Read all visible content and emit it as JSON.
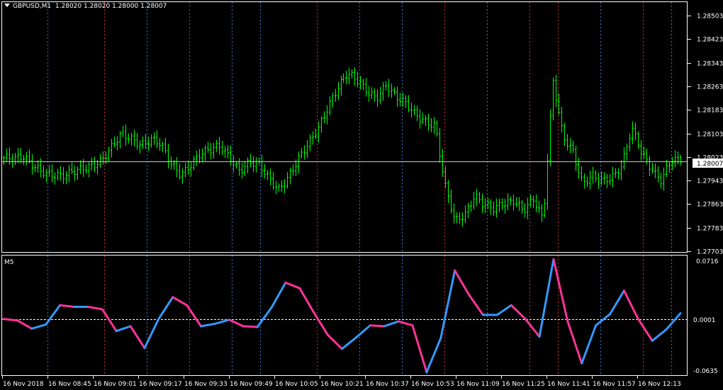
{
  "header": {
    "symbol": "GBPUSD,M1",
    "ohlc": "1.28020 1.28020 1.28000 1.28007",
    "menu_icon": "triangle-down-icon"
  },
  "price_axis": {
    "ticks": [
      1.28503,
      1.28423,
      1.28343,
      1.28263,
      1.28183,
      1.28103,
      1.28023,
      1.27943,
      1.27863,
      1.27783,
      1.27703
    ],
    "current_price": "1.28007",
    "current_value": 1.28007
  },
  "indicator": {
    "name": "M5",
    "max_label": "0.0716",
    "min_label": "-0.0635",
    "zero_label": "0.0001",
    "range": [
      -0.0635,
      0.0716
    ],
    "color_up": "#3399ff",
    "color_down": "#ff3399"
  },
  "time_axis": {
    "labels": [
      "16 Nov 2018",
      "16 Nov 08:45",
      "16 Nov 09:01",
      "16 Nov 09:17",
      "16 Nov 09:33",
      "16 Nov 09:49",
      "16 Nov 10:05",
      "16 Nov 10:21",
      "16 Nov 10:37",
      "16 Nov 10:53",
      "16 Nov 11:09",
      "16 Nov 11:25",
      "16 Nov 11:41",
      "16 Nov 11:57",
      "16 Nov 12:13"
    ]
  },
  "colors": {
    "background": "#000000",
    "bar": "#00ff00",
    "grid_blue": "#3a79c9",
    "grid_red": "#c0323c",
    "text": "#ffffff"
  },
  "chart_data": [
    {
      "type": "line",
      "title": "GBPUSD,M1",
      "ylim": [
        1.27703,
        1.28503
      ],
      "x_labels": [
        "16 Nov 2018",
        "16 Nov 08:45",
        "16 Nov 09:01",
        "16 Nov 09:17",
        "16 Nov 09:33",
        "16 Nov 09:49",
        "16 Nov 10:05",
        "16 Nov 10:21",
        "16 Nov 10:37",
        "16 Nov 10:53",
        "16 Nov 11:09",
        "16 Nov 11:25",
        "16 Nov 11:41",
        "16 Nov 11:57",
        "16 Nov 12:13"
      ],
      "series": [
        {
          "close_approx": [
            1.2802,
            1.2801,
            1.2802,
            1.28,
            1.2798,
            1.2796,
            1.2795,
            1.2797,
            1.2799,
            1.28,
            1.2801,
            1.2805,
            1.281,
            1.2809,
            1.2807,
            1.2808,
            1.2806,
            1.28,
            1.2797,
            1.28,
            1.2803,
            1.2804,
            1.2806,
            1.2803,
            1.2798,
            1.28,
            1.2799,
            1.2795,
            1.2792,
            1.2796,
            1.2801,
            1.2806,
            1.2812,
            1.282,
            1.2826,
            1.283,
            1.2828,
            1.2825,
            1.2823,
            1.2827,
            1.2822,
            1.282,
            1.2817,
            1.2815,
            1.2813,
            1.2792,
            1.278,
            1.2783,
            1.279,
            1.2786,
            1.2784,
            1.2786,
            1.2788,
            1.2785,
            1.2788,
            1.278,
            1.2828,
            1.281,
            1.2805,
            1.2793,
            1.2795,
            1.2794,
            1.2796,
            1.28,
            1.2812,
            1.2803,
            1.2798,
            1.2795,
            1.2802,
            1.2801
          ]
        }
      ]
    },
    {
      "type": "line",
      "title": "M5",
      "ylim": [
        -0.0635,
        0.0716
      ],
      "series": [
        {
          "values": [
            0.0,
            -0.002,
            -0.012,
            -0.007,
            0.017,
            0.015,
            0.015,
            0.012,
            -0.015,
            -0.009,
            -0.036,
            0.0,
            0.027,
            0.017,
            -0.009,
            -0.006,
            -0.001,
            -0.009,
            -0.01,
            0.014,
            0.045,
            0.038,
            0.008,
            -0.02,
            -0.037,
            -0.023,
            -0.008,
            -0.009,
            -0.003,
            -0.008,
            -0.066,
            -0.024,
            0.06,
            0.03,
            0.005,
            0.005,
            0.017,
            0.0,
            -0.022,
            0.074,
            -0.003,
            -0.055,
            -0.008,
            0.006,
            0.035,
            0.0,
            -0.027,
            -0.013,
            0.007
          ]
        }
      ]
    }
  ]
}
